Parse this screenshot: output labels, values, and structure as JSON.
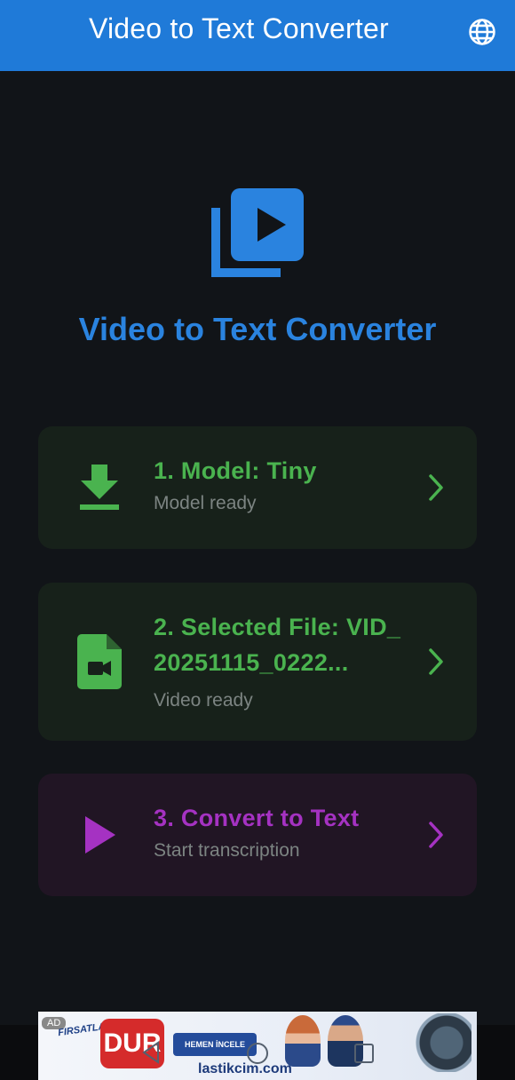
{
  "appbar": {
    "title": "Video to Text Converter",
    "language_icon": "globe-icon"
  },
  "hero": {
    "icon": "video-library-icon",
    "title": "Video to Text Converter"
  },
  "cards": [
    {
      "title": "1. Model: Tiny",
      "subtitle": "Model ready",
      "icon": "download-icon"
    },
    {
      "title": "2. Selected File: VID_ 20251115_0222...",
      "subtitle": "Video ready",
      "icon": "video-file-icon"
    },
    {
      "title": "3. Convert to Text",
      "subtitle": "Start transcription",
      "icon": "play-icon"
    }
  ],
  "ad": {
    "badge": "AD",
    "tagline": "FIRSATLAR",
    "headline": "DUR",
    "cta": "HEMEN İNCELE",
    "domain": "lastikcim.com"
  },
  "colors": {
    "appbar": "#1f7ad8",
    "background": "#111418",
    "accent_blue": "#2a83df",
    "green": "#4ab34f",
    "purple": "#a532c2"
  }
}
